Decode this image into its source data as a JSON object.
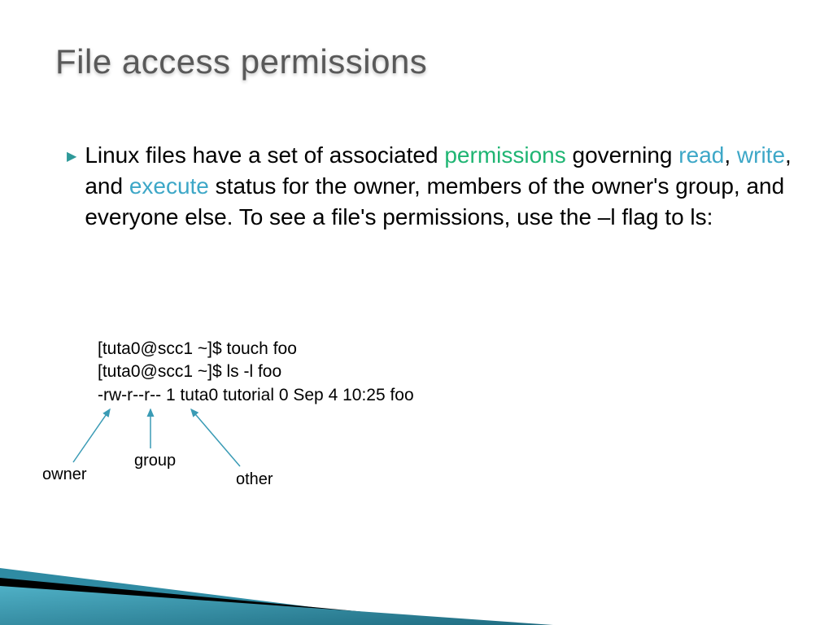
{
  "title": "File access permissions",
  "bullet": {
    "p1": "Linux files have a set of associated ",
    "kw_permissions": "permissions",
    "p2": " governing ",
    "kw_read": "read",
    "p3": ", ",
    "kw_write": "write",
    "p4": ", and ",
    "kw_execute": "execute",
    "p5": " status for the owner, members of the owner's group, and everyone else. To see a file's permissions, use the –l flag to ls:"
  },
  "terminal": {
    "line1": "[tuta0@scc1 ~]$ touch foo",
    "line2": "[tuta0@scc1 ~]$ ls -l foo",
    "line3": "-rw-r--r-- 1 tuta0 tutorial 0 Sep  4 10:25 foo"
  },
  "labels": {
    "owner": "owner",
    "group": "group",
    "other": "other"
  }
}
